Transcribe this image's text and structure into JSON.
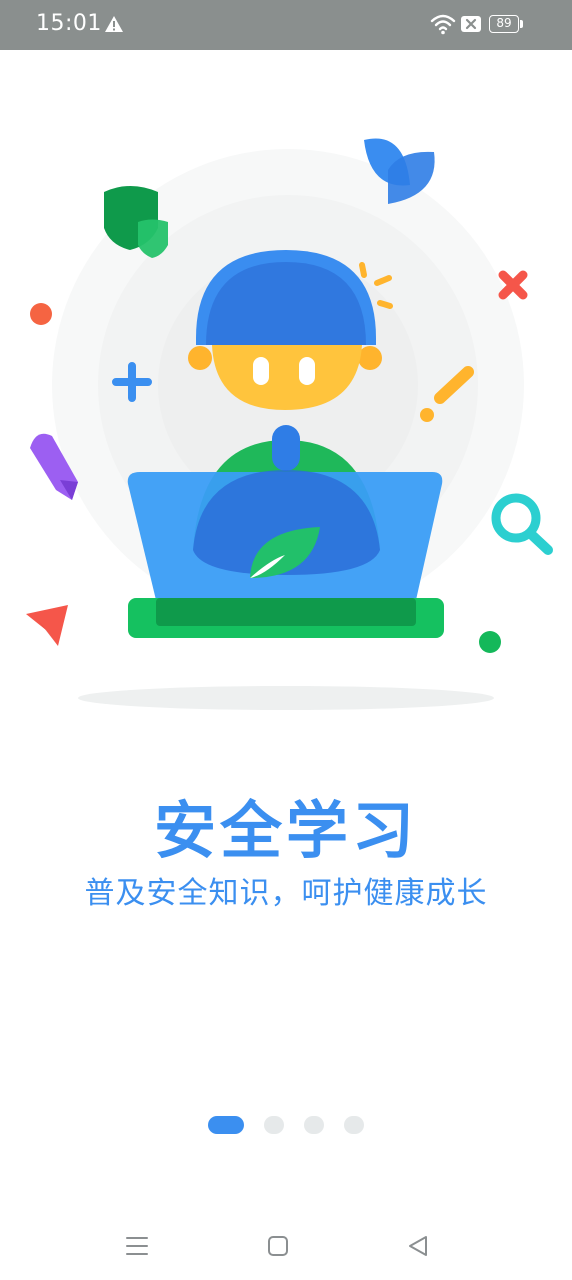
{
  "status_bar": {
    "time": "15:01",
    "battery": "89",
    "icons": [
      "warning-icon",
      "wifi-icon",
      "x-box-icon",
      "battery-icon"
    ]
  },
  "onboarding": {
    "title": "安全学习",
    "subtitle": "普及安全知识，呵护健康成长",
    "page_count": 4,
    "active_page": 1
  },
  "nav_bar": {
    "icons": [
      "menu-icon",
      "home-square-icon",
      "back-triangle-icon"
    ]
  },
  "colors": {
    "accent": "#3b8ff0",
    "status_bar_bg": "#8a8f8e",
    "green": "#14b85a",
    "inactive_dot": "#e6e9ea"
  }
}
